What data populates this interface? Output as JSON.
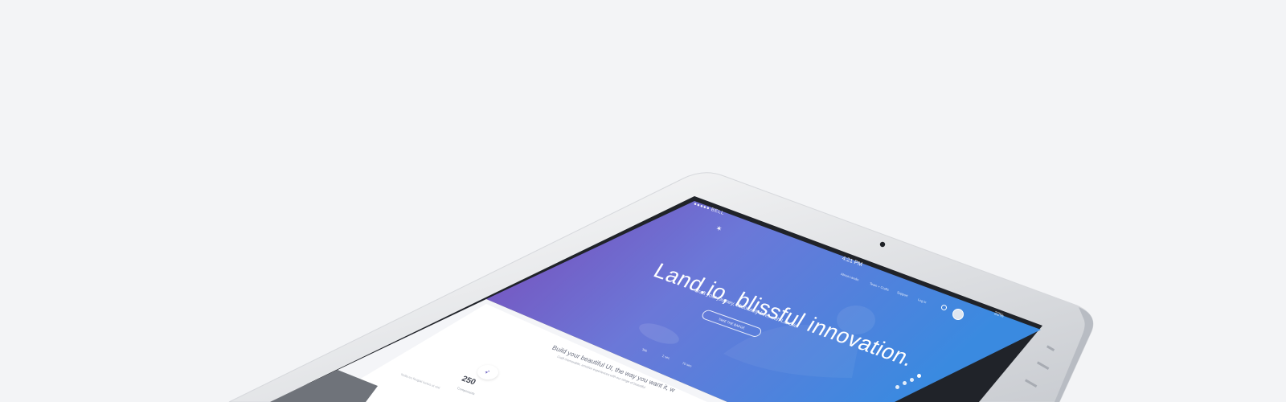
{
  "status_bar": {
    "carrier": "●●●●● BELL",
    "time": "4:21 PM",
    "battery": "22%"
  },
  "nav": {
    "items": [
      {
        "label": "About Landio"
      },
      {
        "label": "Team + Crafts"
      },
      {
        "label": "Support"
      },
      {
        "label": "Log in"
      }
    ]
  },
  "hero": {
    "title": "Land.io, blissful innovation.",
    "subtitle": "Craft your journey, absolutely free, with Land.io.",
    "button_label": "TAKE THE BADGE",
    "stats": [
      {
        "label": "3kb"
      },
      {
        "label": "2 sec"
      },
      {
        "label": "70 seo"
      }
    ]
  },
  "section": {
    "title": "Build your beautiful UI, the way you want it, w",
    "subtitle": "Craft memorable, emotive experiences with our range of beautiful",
    "stat_number": "250",
    "stat_label": "Components",
    "paragraph": "Nulla eu feugiat luctus ut nisl"
  },
  "colors": {
    "hero_gradient_start": "#7b4fc0",
    "hero_gradient_end": "#4a90e2",
    "device_frame": "#ffffff",
    "background": "#f3f4f6"
  }
}
